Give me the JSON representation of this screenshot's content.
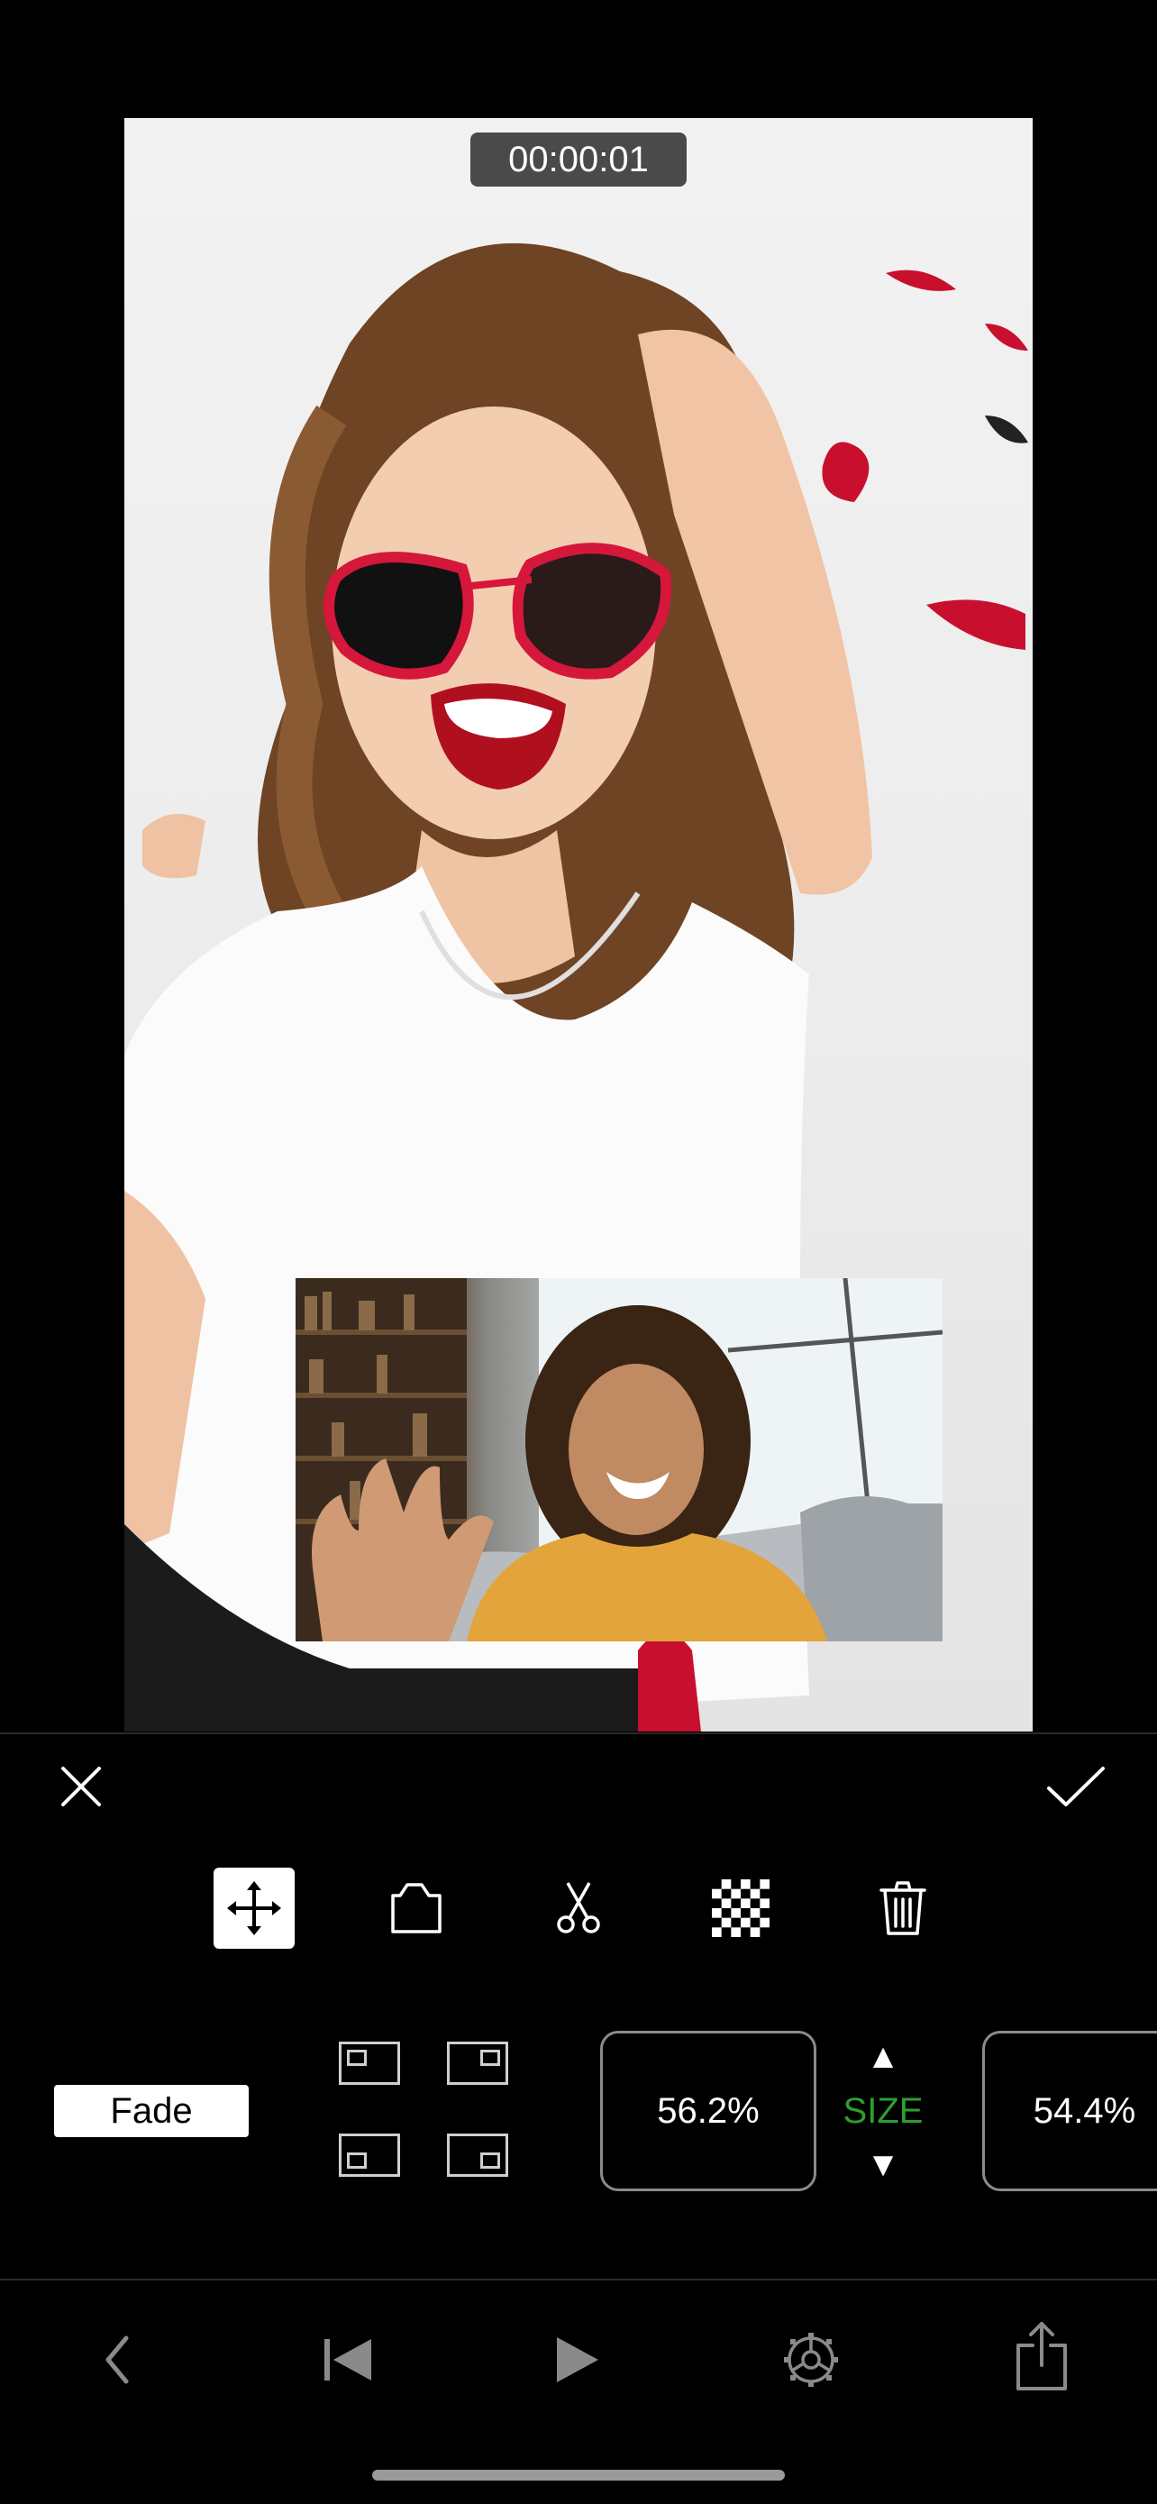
{
  "preview": {
    "timecode": "00:00:01"
  },
  "editor": {
    "cancel_icon": "close-icon",
    "confirm_icon": "checkmark-icon",
    "tools": [
      {
        "name": "move-tool",
        "icon": "move-arrows-icon",
        "active": true
      },
      {
        "name": "crop-tool",
        "icon": "crop-icon",
        "active": false
      },
      {
        "name": "cut-tool",
        "icon": "scissors-icon",
        "active": false
      },
      {
        "name": "opacity-tool",
        "icon": "checkerboard-icon",
        "active": false
      },
      {
        "name": "delete-tool",
        "icon": "trash-icon",
        "active": false
      }
    ],
    "fade_label": "Fade",
    "size_label": "SIZE",
    "size_value": "56.2%",
    "second_value": "54.4%",
    "size_label_color": "#2f9e2f"
  },
  "playback": {
    "buttons": [
      "back-icon",
      "skip-to-start-icon",
      "play-icon",
      "settings-gear-icon",
      "share-icon"
    ]
  }
}
